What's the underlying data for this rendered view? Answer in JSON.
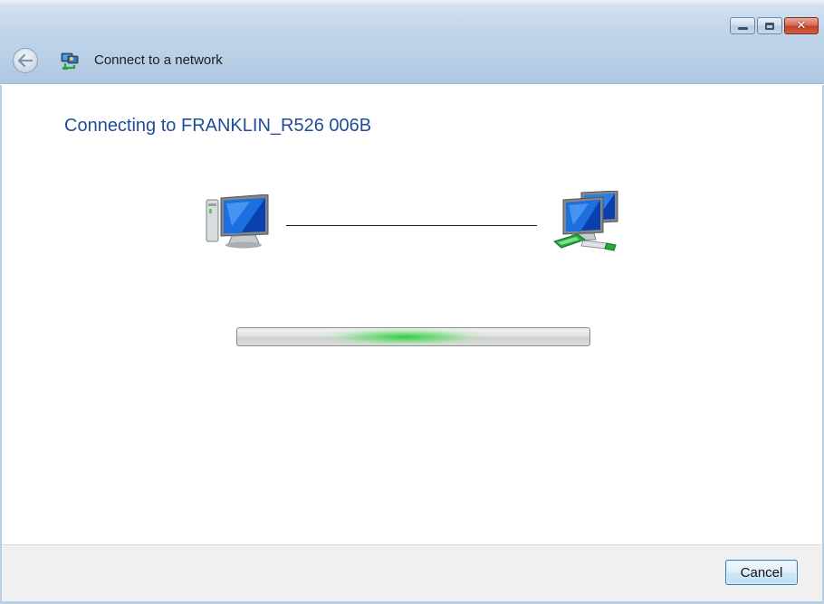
{
  "window": {
    "title": "Connect to a network",
    "caption_buttons": {
      "minimize_icon": "minimize-icon",
      "maximize_icon": "maximize-icon",
      "close_icon": "close-icon"
    },
    "back_icon": "back-arrow-icon"
  },
  "content": {
    "heading": "Connecting to FRANKLIN_R526 006B",
    "left_icon": "computer-icon",
    "right_icon": "network-icon",
    "progress": {
      "state": "indeterminate",
      "color": "#2fd34a"
    }
  },
  "footer": {
    "cancel_label": "Cancel"
  },
  "colors": {
    "heading": "#1e4e9a",
    "title_bar": "#c3d6ea",
    "footer_bg": "#f0f0f0",
    "button_border": "#3c7fb1"
  }
}
